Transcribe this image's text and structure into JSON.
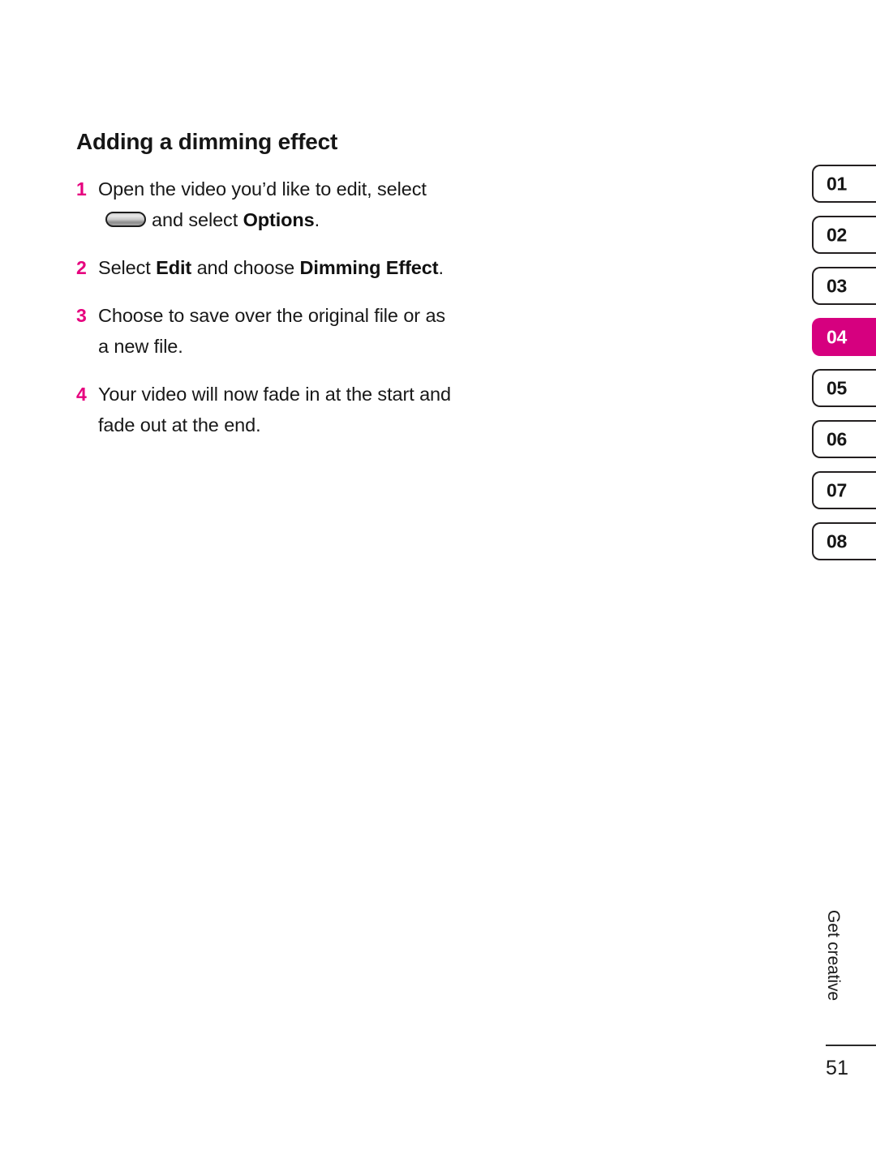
{
  "document": {
    "heading": "Adding a dimming effect",
    "steps": [
      {
        "number": "1",
        "segments": [
          {
            "text": "Open the video you’d like to edit, select ",
            "bold": false
          },
          {
            "icon": "softkey-button-icon"
          },
          {
            "text": "and select ",
            "bold": false
          },
          {
            "text": "Options",
            "bold": true
          },
          {
            "text": ".",
            "bold": false
          }
        ]
      },
      {
        "number": "2",
        "segments": [
          {
            "text": "Select ",
            "bold": false
          },
          {
            "text": "Edit",
            "bold": true
          },
          {
            "text": " and choose ",
            "bold": false
          },
          {
            "text": "Dimming Effect",
            "bold": true
          },
          {
            "text": ".",
            "bold": false
          }
        ]
      },
      {
        "number": "3",
        "segments": [
          {
            "text": "Choose to save over the original file or as a new file.",
            "bold": false
          }
        ]
      },
      {
        "number": "4",
        "segments": [
          {
            "text": "Your video will now fade in at the start and fade out at the end.",
            "bold": false
          }
        ]
      }
    ]
  },
  "tabs": {
    "items": [
      {
        "label": "01",
        "active": false
      },
      {
        "label": "02",
        "active": false
      },
      {
        "label": "03",
        "active": false
      },
      {
        "label": "04",
        "active": true
      },
      {
        "label": "05",
        "active": false
      },
      {
        "label": "06",
        "active": false
      },
      {
        "label": "07",
        "active": false
      },
      {
        "label": "08",
        "active": false
      }
    ],
    "active_label": "04"
  },
  "footer": {
    "section_label": "Get creative",
    "page_number": "51"
  },
  "colors": {
    "accent_magenta": "#d6007f",
    "list_number_pink": "#e6007e",
    "text": "#1a1a1a",
    "background": "#ffffff"
  }
}
